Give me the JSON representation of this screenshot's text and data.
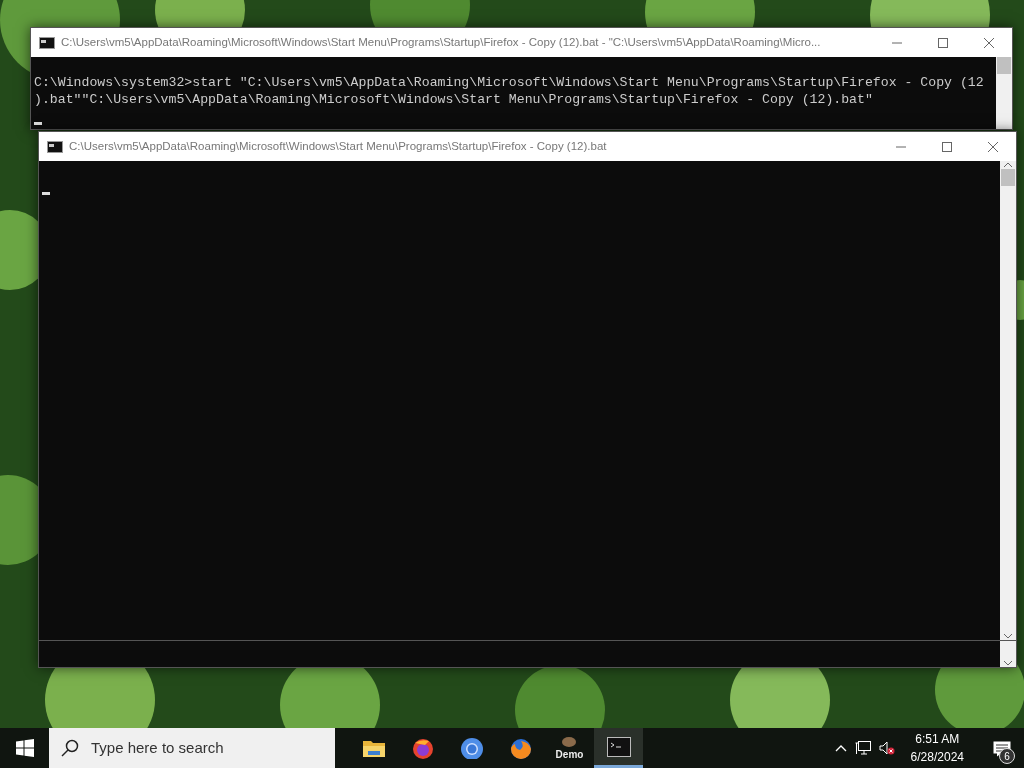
{
  "windows": [
    {
      "title": "C:\\Users\\vm5\\AppData\\Roaming\\Microsoft\\Windows\\Start Menu\\Programs\\Startup\\Firefox - Copy (12).bat - \"C:\\Users\\vm5\\AppData\\Roaming\\Micro...",
      "lines": [
        "C:\\Windows\\system32>start \"C:\\Users\\vm5\\AppData\\Roaming\\Microsoft\\Windows\\Start Menu\\Programs\\Startup\\Firefox - Copy (12",
        ").bat\"\"C:\\Users\\vm5\\AppData\\Roaming\\Microsoft\\Windows\\Start Menu\\Programs\\Startup\\Firefox - Copy (12).bat\""
      ]
    },
    {
      "title": "C:\\Users\\vm5\\AppData\\Roaming\\Microsoft\\Windows\\Start Menu\\Programs\\Startup\\Firefox - Copy (12).bat"
    }
  ],
  "taskbar": {
    "search": {
      "placeholder": "Type here to search"
    },
    "apps": [
      {
        "kind": "folder",
        "selected": false
      },
      {
        "kind": "firefox-purple",
        "selected": false
      },
      {
        "kind": "chromium",
        "selected": false
      },
      {
        "kind": "firefox",
        "selected": false
      },
      {
        "kind": "demo",
        "label": "Demo",
        "selected": false
      },
      {
        "kind": "console",
        "selected": true
      }
    ],
    "time": "6:51 AM",
    "date": "6/28/2024",
    "notifications": "6"
  }
}
